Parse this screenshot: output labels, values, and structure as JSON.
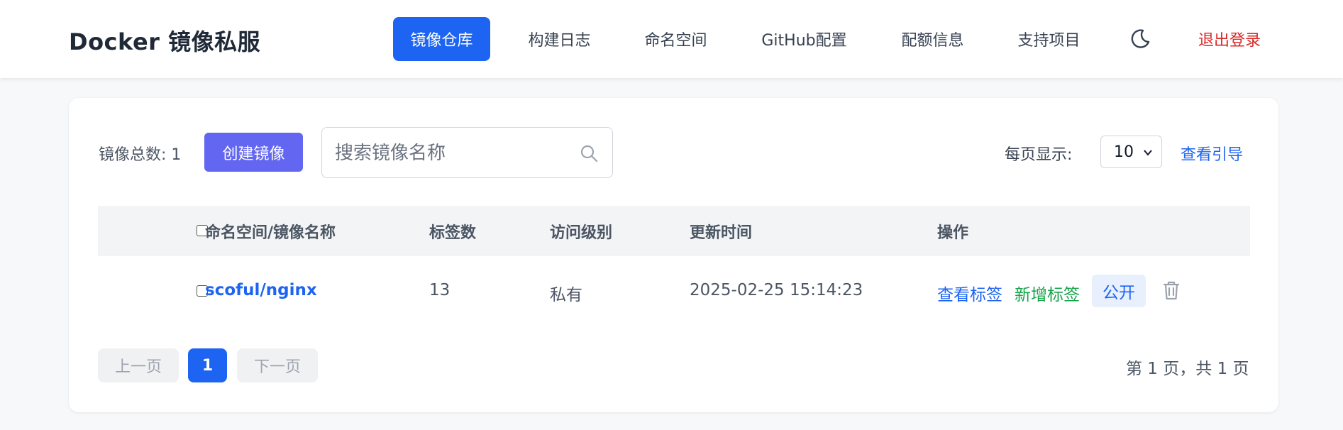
{
  "header": {
    "brand": "Docker 镜像私服",
    "nav": [
      {
        "label": "镜像仓库",
        "active": true
      },
      {
        "label": "构建日志"
      },
      {
        "label": "命名空间"
      },
      {
        "label": "GitHub配置"
      },
      {
        "label": "配额信息"
      },
      {
        "label": "支持项目"
      }
    ],
    "theme_icon": "moon-icon",
    "logout_label": "退出登录"
  },
  "toolbar": {
    "total_label": "镜像总数: 1",
    "create_label": "创建镜像",
    "search_placeholder": "搜索镜像名称",
    "per_page_label": "每页显示:",
    "per_page_value": "10",
    "guide_label": "查看引导"
  },
  "table": {
    "headers": [
      "命名空间/镜像名称",
      "标签数",
      "访问级别",
      "更新时间",
      "操作"
    ],
    "rows": [
      {
        "name": "scoful/nginx",
        "tags": "13",
        "access": "私有",
        "updated": "2025-02-25 15:14:23",
        "actions": {
          "view_tags": "查看标签",
          "add_tag": "新增标签",
          "make_public": "公开",
          "delete_icon": "trash-icon"
        }
      }
    ]
  },
  "pagination": {
    "prev_label": "上一页",
    "current_page": "1",
    "next_label": "下一页",
    "info": "第 1 页，共 1 页"
  },
  "colors": {
    "primary": "#1d64f2",
    "create": "#6366f1",
    "logout": "#dc2626",
    "add_tag": "#16a34a"
  }
}
